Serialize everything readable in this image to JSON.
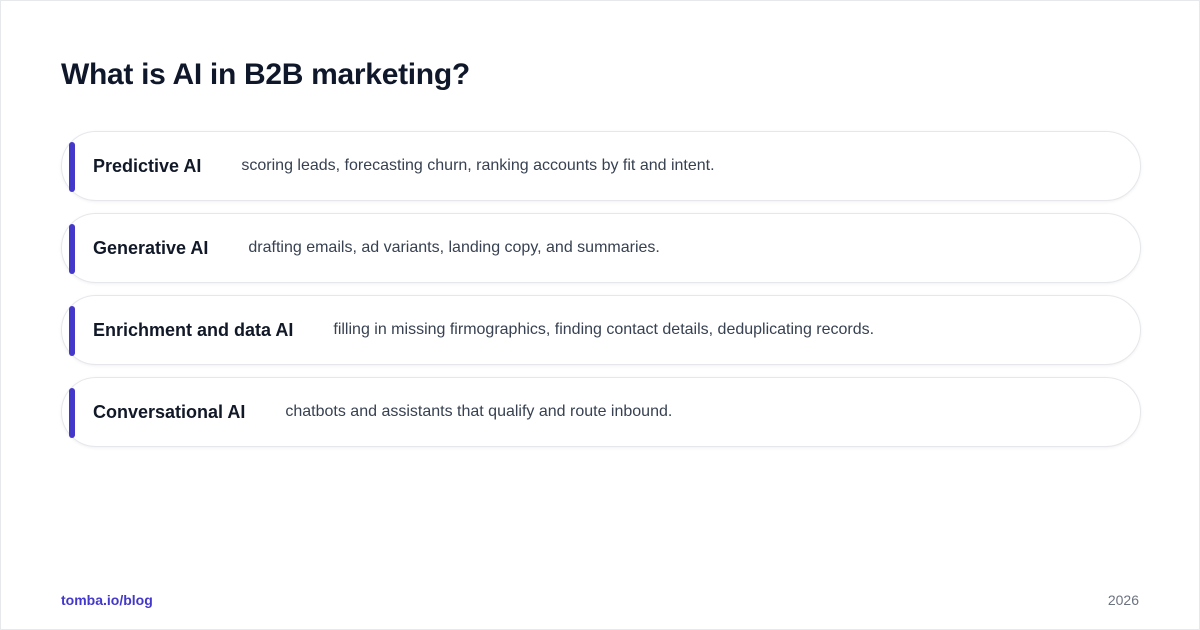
{
  "title": "What is AI in B2B marketing?",
  "accent_color": "#4338ca",
  "items": [
    {
      "term": "Predictive AI",
      "description": "scoring leads, forecasting churn, ranking accounts by fit and intent."
    },
    {
      "term": "Generative AI",
      "description": "drafting emails, ad variants, landing copy, and summaries."
    },
    {
      "term": "Enrichment and data AI",
      "description": "filling in missing firmographics, finding contact details, deduplicating records."
    },
    {
      "term": "Conversational AI",
      "description": "chatbots and assistants that qualify and route inbound."
    }
  ],
  "footer": {
    "link": "tomba.io/blog",
    "year": "2026"
  }
}
